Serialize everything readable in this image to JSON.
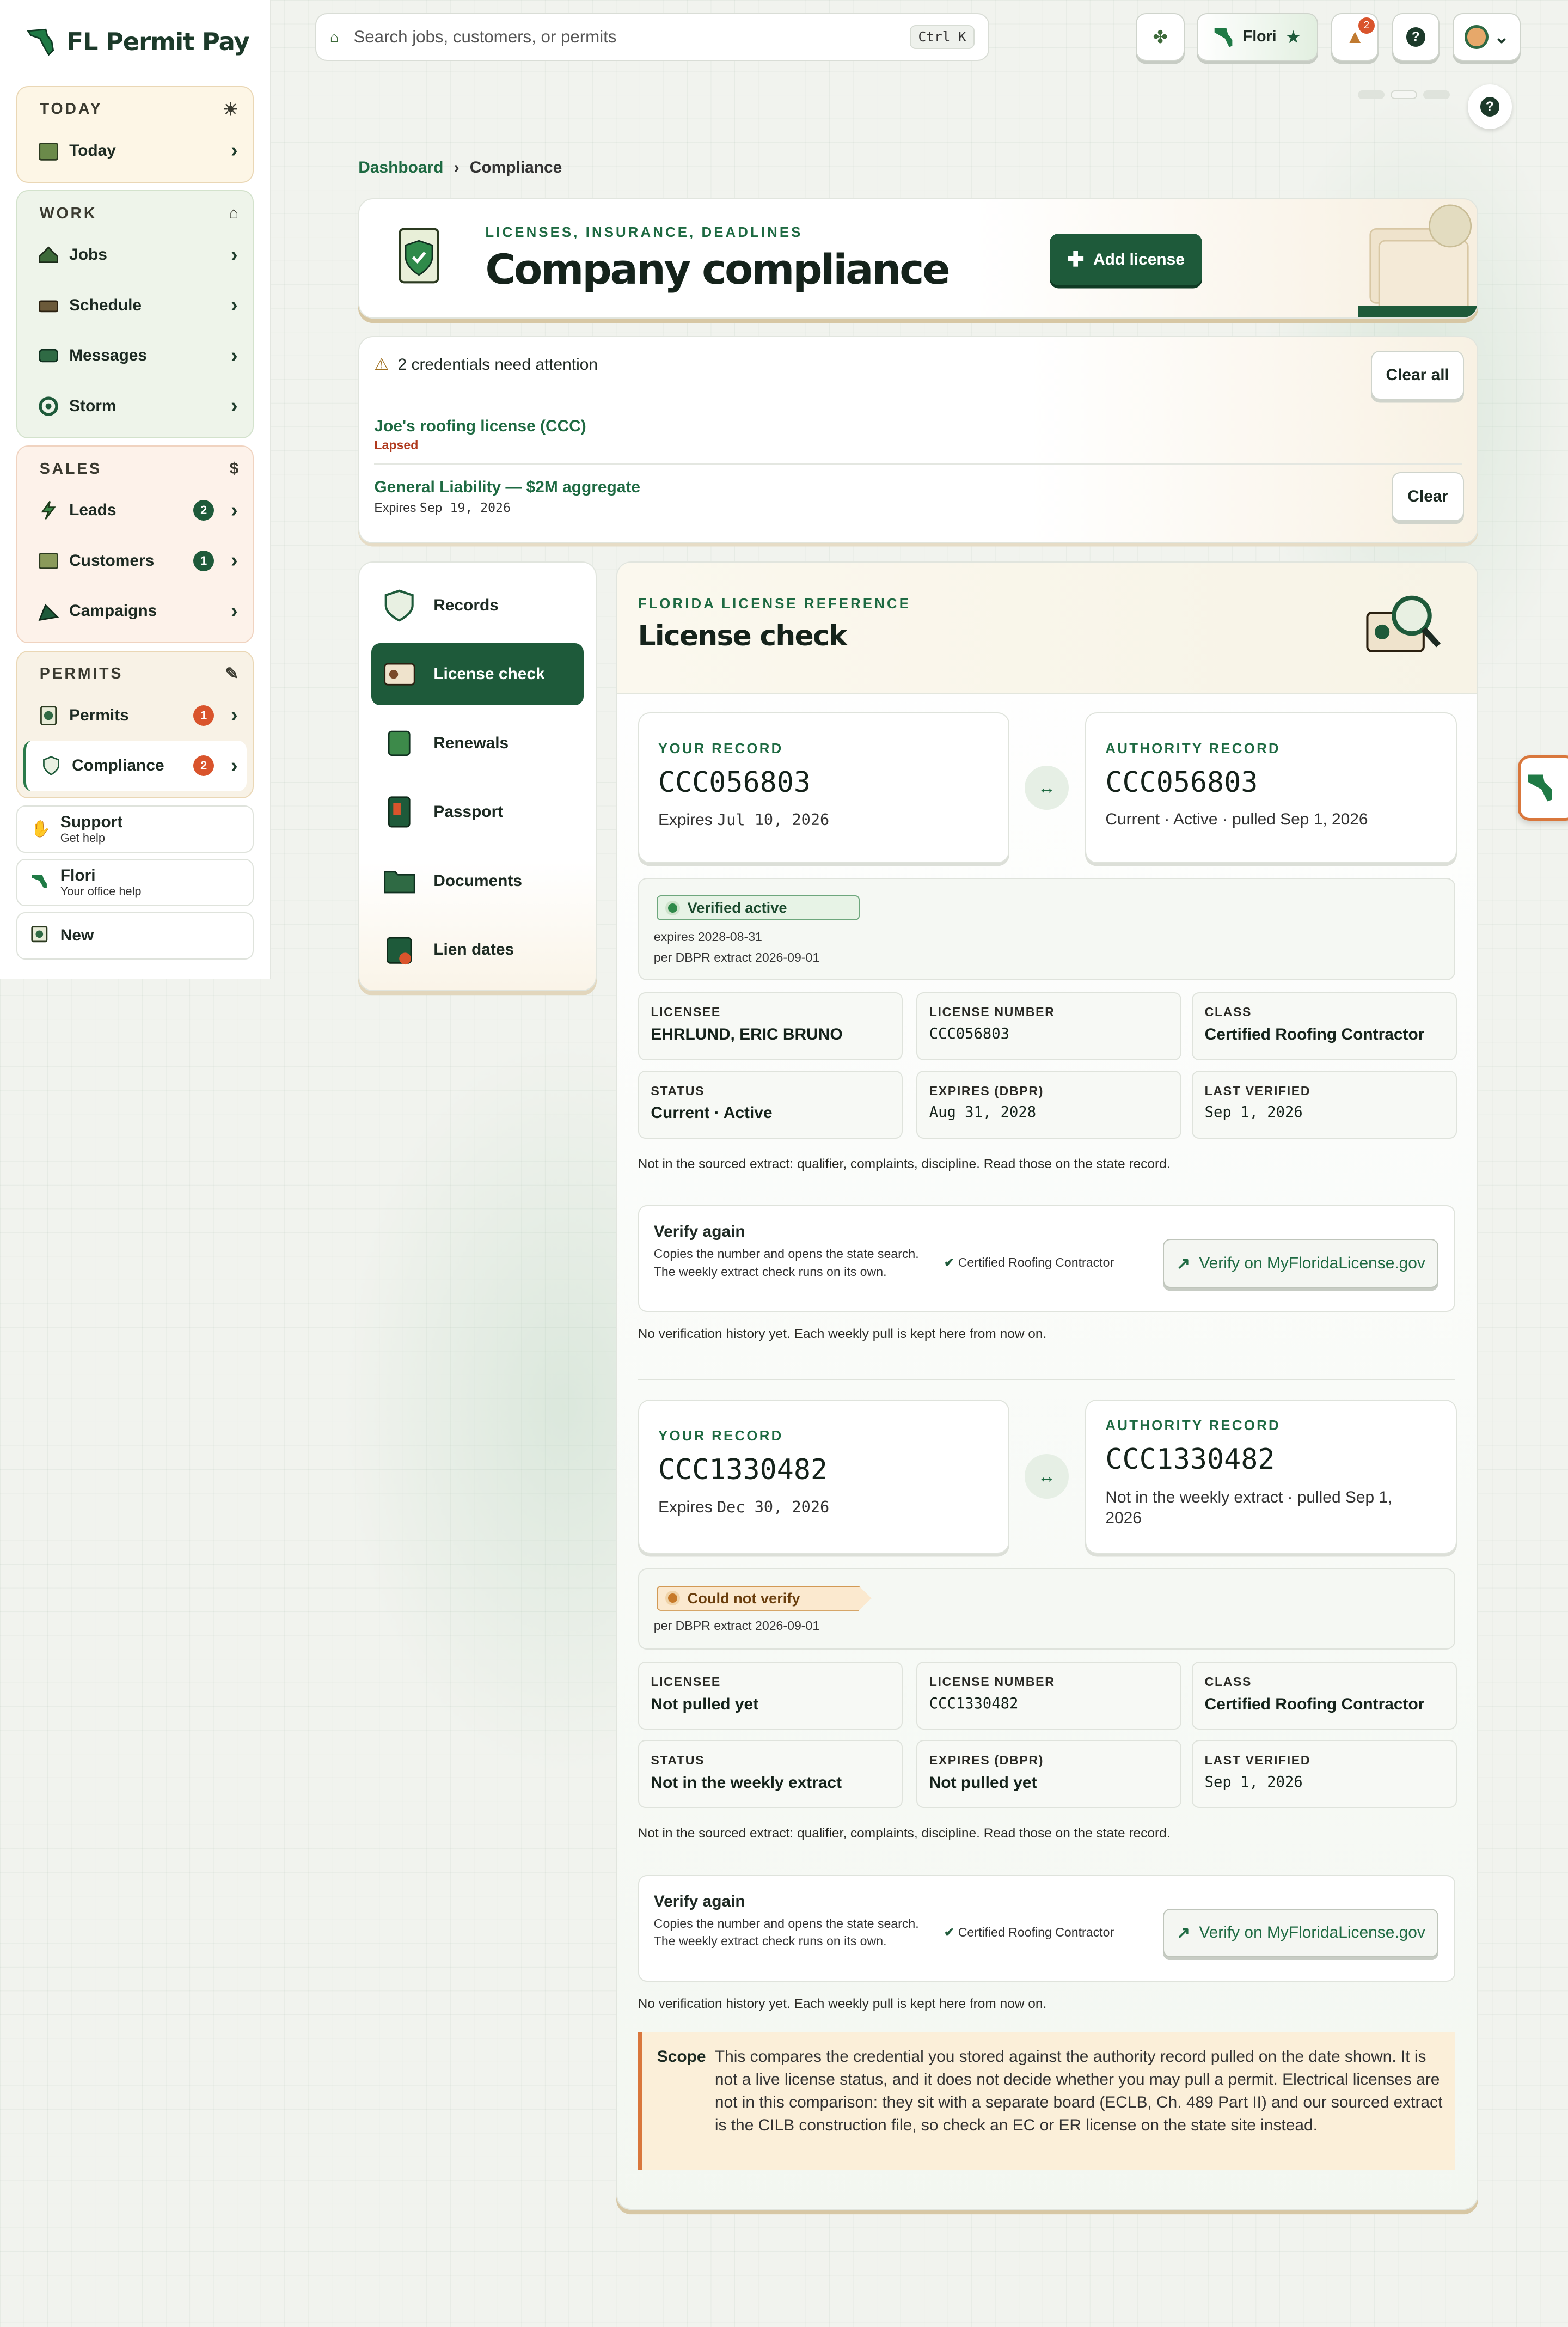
{
  "app": {
    "name": "FL Permit Pay"
  },
  "sidebar": {
    "groups": [
      {
        "title": "TODAY",
        "items": [
          {
            "label": "Today"
          }
        ]
      },
      {
        "title": "WORK",
        "items": [
          {
            "label": "Jobs"
          },
          {
            "label": "Schedule"
          },
          {
            "label": "Messages"
          },
          {
            "label": "Storm"
          }
        ]
      },
      {
        "title": "SALES",
        "items": [
          {
            "label": "Leads",
            "badge": "2"
          },
          {
            "label": "Customers",
            "badge": "1"
          },
          {
            "label": "Campaigns"
          }
        ]
      },
      {
        "title": "PERMITS",
        "items": [
          {
            "label": "Permits",
            "badge": "1"
          },
          {
            "label": "Compliance",
            "badge": "2"
          }
        ]
      }
    ],
    "extras": [
      {
        "title": "Support",
        "subtitle": "Get help"
      },
      {
        "title": "Flori",
        "subtitle": "Your office help"
      },
      {
        "title": "New"
      }
    ]
  },
  "topbar": {
    "search_placeholder": "Search jobs, customers, or permits",
    "shortcut": "Ctrl K",
    "assistant_name": "Flori",
    "notifications": "2"
  },
  "breadcrumb": {
    "parent": "Dashboard",
    "separator": "›",
    "current": "Compliance"
  },
  "hero": {
    "kicker": "LICENSES, INSURANCE, DEADLINES",
    "title": "Company compliance",
    "add_label": "Add license"
  },
  "alerts": {
    "summary": "2 credentials need attention",
    "clear_all": "Clear all",
    "items": [
      {
        "title": "Joe's roofing license (CCC)",
        "status": "Lapsed"
      },
      {
        "title": "General Liability — $2M aggregate",
        "expires_prefix": "Expires",
        "expires": "Sep 19, 2026",
        "clear": "Clear"
      }
    ]
  },
  "tabs": [
    {
      "label": "Records"
    },
    {
      "label": "License check"
    },
    {
      "label": "Renewals"
    },
    {
      "label": "Passport"
    },
    {
      "label": "Documents"
    },
    {
      "label": "Lien dates"
    }
  ],
  "panel": {
    "kicker": "FLORIDA LICENSE REFERENCE",
    "title": "License check"
  },
  "checks": [
    {
      "your_label": "YOUR RECORD",
      "your_number": "CCC056803",
      "your_expires_prefix": "Expires",
      "your_expires": "Jul 10, 2026",
      "auth_label": "AUTHORITY RECORD",
      "auth_number": "CCC056803",
      "auth_status": "Current · Active · pulled Sep 1, 2026",
      "pill": "Verified active",
      "pill_line1": "expires 2028-08-31",
      "pill_line2": "per DBPR extract 2026-09-01",
      "fields": [
        {
          "label": "LICENSEE",
          "value": "EHRLUND, ERIC BRUNO"
        },
        {
          "label": "LICENSE NUMBER",
          "value": "CCC056803"
        },
        {
          "label": "CLASS",
          "value": "Certified Roofing Contractor"
        },
        {
          "label": "STATUS",
          "value": "Current · Active"
        },
        {
          "label": "EXPIRES (DBPR)",
          "value": "Aug 31, 2028"
        },
        {
          "label": "LAST VERIFIED",
          "value": "Sep 1, 2026"
        }
      ],
      "note": "Not in the sourced extract: qualifier, complaints, discipline. Read those on the state record.",
      "verify_title": "Verify again",
      "verify_desc": "Copies the number and opens the state search. The weekly extract check runs on its own.",
      "verify_class": "Certified Roofing Contractor",
      "verify_btn": "Verify on MyFloridaLicense.gov",
      "history": "No verification history yet. Each weekly pull is kept here from now on."
    },
    {
      "your_label": "YOUR RECORD",
      "your_number": "CCC1330482",
      "your_expires_prefix": "Expires",
      "your_expires": "Dec 30, 2026",
      "auth_label": "AUTHORITY RECORD",
      "auth_number": "CCC1330482",
      "auth_status": "Not in the weekly extract · pulled Sep 1, 2026",
      "pill": "Could not verify",
      "pill_line2": "per DBPR extract 2026-09-01",
      "fields": [
        {
          "label": "LICENSEE",
          "value": "Not pulled yet"
        },
        {
          "label": "LICENSE NUMBER",
          "value": "CCC1330482"
        },
        {
          "label": "CLASS",
          "value": "Certified Roofing Contractor"
        },
        {
          "label": "STATUS",
          "value": "Not in the weekly extract"
        },
        {
          "label": "EXPIRES (DBPR)",
          "value": "Not pulled yet"
        },
        {
          "label": "LAST VERIFIED",
          "value": "Sep 1, 2026"
        }
      ],
      "note": "Not in the sourced extract: qualifier, complaints, discipline. Read those on the state record.",
      "verify_title": "Verify again",
      "verify_desc": "Copies the number and opens the state search. The weekly extract check runs on its own.",
      "verify_class": "Certified Roofing Contractor",
      "verify_btn": "Verify on MyFloridaLicense.gov",
      "history": "No verification history yet. Each weekly pull is kept here from now on."
    }
  ],
  "scope": {
    "label": "Scope",
    "text": "This compares the credential you stored against the authority record pulled on the date shown. It is not a live license status, and it does not decide whether you may pull a permit. Electrical licenses are not in this comparison: they sit with a separate board (ECLB, Ch. 489 Part II) and our sourced extract is the CILB construction file, so check an EC or ER license on the state site instead."
  },
  "colors": {
    "brand_green": "#1e5a3a",
    "accent_orange": "#d9542c",
    "scope_border": "#d9773c"
  }
}
